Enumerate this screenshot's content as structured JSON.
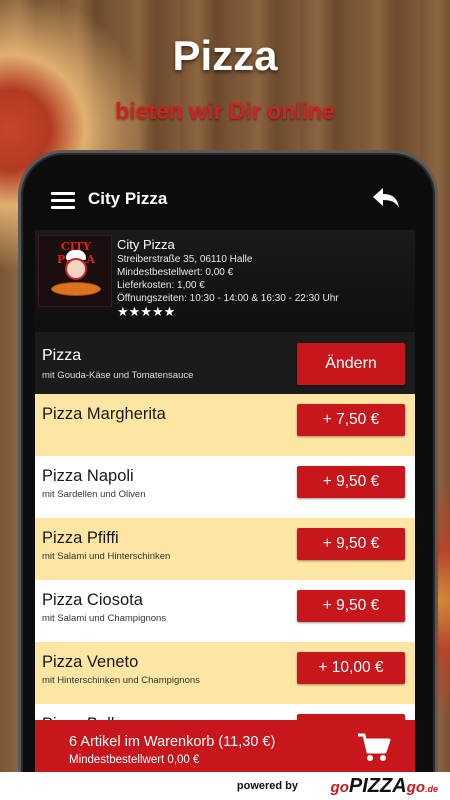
{
  "hero": {
    "title": "Pizza",
    "subtitle": "bieten wir Dir online"
  },
  "header": {
    "title": "City Pizza",
    "menu_icon": "hamburger-menu-icon",
    "back_icon": "back-arrow-icon"
  },
  "shop": {
    "logo_text": "CITY PIZZA",
    "name": "City Pizza",
    "address": "Streiberstraße 35, 06110 Halle",
    "min_order": "Mindestbestellwert: 0,00 €",
    "delivery_cost": "Lieferkosten: 1,00 €",
    "opening_hours": "Öffnungszeiten: 10:30 - 14:00 & 16:30 - 22:30 Uhr",
    "rating": "★★★★★",
    "rating_value": 5,
    "rating_max": 5
  },
  "category": {
    "title": "Pizza",
    "subtitle": "mit Gouda-Käse und Tomatensauce",
    "change_label": "Ändern"
  },
  "items": [
    {
      "name": "Pizza Margherita",
      "desc": "",
      "price": "+ 7,50 €"
    },
    {
      "name": "Pizza Napoli",
      "desc": "mit Sardellen und Oliven",
      "price": "+ 9,50 €"
    },
    {
      "name": "Pizza Pfiffi",
      "desc": "mit Salami und Hinterschinken",
      "price": "+ 9,50 €"
    },
    {
      "name": "Pizza Ciosota",
      "desc": "mit Salami und Champignons",
      "price": "+ 9,50 €"
    },
    {
      "name": "Pizza Veneto",
      "desc": "mit Hinterschinken und Champignons",
      "price": "+ 10,00 €"
    },
    {
      "name": "Pizza Bella",
      "desc": "",
      "price": ""
    }
  ],
  "cart": {
    "summary": "6 Artikel im Warenkorb (11,30 €)",
    "min_order": "Mindestbestellwert 0,00 €",
    "icon": "shopping-cart-icon"
  },
  "footer": {
    "powered_by": "powered by",
    "brand_prefix": "go",
    "brand_main": "PIZZA",
    "brand_suffix": "go",
    "brand_tld": ".de"
  },
  "colors": {
    "accent_red": "#c8161d",
    "item_odd_bg": "#fde6a3",
    "item_even_bg": "#ffffff"
  }
}
